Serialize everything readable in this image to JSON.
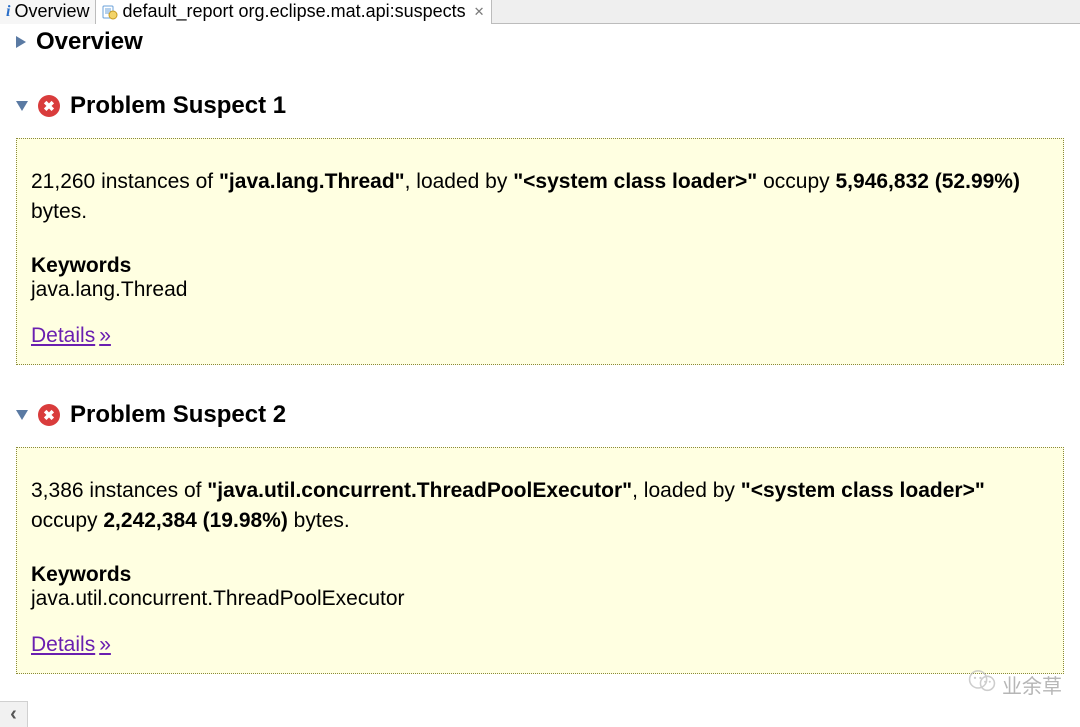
{
  "tabs": {
    "overview": "Overview",
    "active": "default_report  org.eclipse.mat.api:suspects"
  },
  "sections": {
    "overview": {
      "title": "Overview"
    },
    "suspect1": {
      "title": "Problem Suspect 1",
      "body": {
        "instances": "21,260",
        "text_prefix": " instances of ",
        "class": "\"java.lang.Thread\"",
        "text_middle": ", loaded by ",
        "loader": "\"<system class loader>\"",
        "text_occupy": " occupy ",
        "bytes": "5,946,832 (52.99%)",
        "text_suffix": " bytes."
      },
      "keywords_label": "Keywords",
      "keywords_text": "java.lang.Thread",
      "details_label": "Details",
      "details_arrow": "»"
    },
    "suspect2": {
      "title": "Problem Suspect 2",
      "body": {
        "instances": "3,386",
        "text_prefix": " instances of ",
        "class": "\"java.util.concurrent.ThreadPoolExecutor\"",
        "text_middle": ", loaded by ",
        "loader": "\"<system class loader>\"",
        "text_occupy": " occupy ",
        "bytes": "2,242,384 (19.98%)",
        "text_suffix": " bytes."
      },
      "keywords_label": "Keywords",
      "keywords_text": "java.util.concurrent.ThreadPoolExecutor",
      "details_label": "Details",
      "details_arrow": "»"
    }
  },
  "watermark": "业余草",
  "scroll_glyph": "‹"
}
